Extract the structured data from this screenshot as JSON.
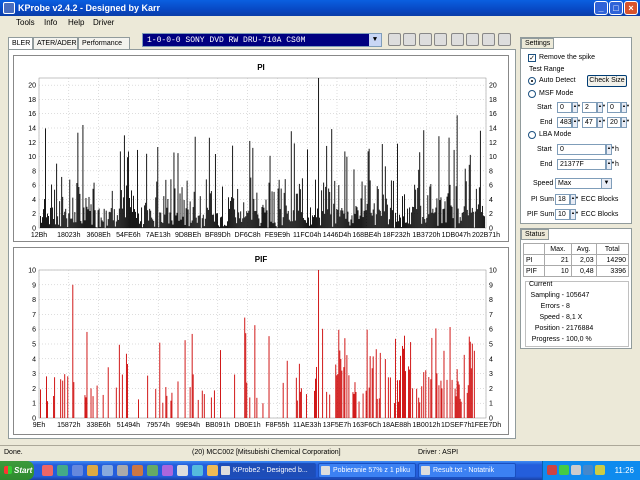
{
  "window": {
    "title": "KProbe v2.4.2 - Designed by Karr"
  },
  "menu": {
    "items": [
      "Tools",
      "Info",
      "Help",
      "Driver"
    ]
  },
  "drive": {
    "selected": "1-0-0-0 SONY    DVD RW DRU-710A  CS0M"
  },
  "tabs": [
    "BLER",
    "ATER/ADER",
    "Performance"
  ],
  "settings": {
    "title": "Settings",
    "remove_spike": "Remove the spike",
    "test_range": "Test Range",
    "auto_detect": "Auto Detect",
    "check_size": "Check Size",
    "msf_mode": "MSF Mode",
    "start_label": "Start",
    "end_label": "End",
    "msf_start": [
      "0",
      "2",
      "0"
    ],
    "msf_end": [
      "483",
      "47",
      "20"
    ],
    "lba_mode": "LBA Mode",
    "lba_start": "0",
    "lba_end": "21377F",
    "h": "h",
    "speed_label": "Speed",
    "speed_value": "Max",
    "pi_sum_label": "PI Sum",
    "pi_sum_value": "18",
    "pif_sum_label": "PIF Sum",
    "pif_sum_value": "10",
    "ecc_blocks": "ECC Blocks"
  },
  "status": {
    "title": "Status",
    "headers": [
      "",
      "Max.",
      "Avg.",
      "Total"
    ],
    "rows": [
      [
        "PI",
        "21",
        "2,03",
        "14290"
      ],
      [
        "PIF",
        "10",
        "0,48",
        "3396"
      ]
    ],
    "current_title": "Current",
    "current": [
      {
        "k": "Sampling -",
        "v": "105647"
      },
      {
        "k": "Errors -",
        "v": "8"
      },
      {
        "k": "Speed -",
        "v": "8,1  X"
      },
      {
        "k": "Position -",
        "v": "2176884"
      },
      {
        "k": "Progress -",
        "v": "100,0 %"
      }
    ]
  },
  "statusbar": {
    "left": "Done.",
    "media": "(20) MCC002 [Mitsubishi Chemical Corporation]",
    "driver": "Driver : ASPI"
  },
  "taskbar": {
    "start": "Start",
    "tasks": [
      "KProbe2 - Designed b...",
      "Pobieranie 57% z 1 pliku",
      "Result.txt - Notatnik"
    ],
    "clock": "11:26"
  },
  "colors": {
    "pi_bars": "#000000",
    "pif_bars": "#CC0000",
    "accent": "#0A5FE0"
  },
  "chart_data": [
    {
      "type": "bar",
      "title": "PI",
      "categories": [
        "12Bh",
        "18023h",
        "3608Eh",
        "54FE6h",
        "7AE13h",
        "9D8BEh",
        "BF89Dh",
        "DF6C8h",
        "FE9E9h",
        "11FC04h",
        "1446D4h",
        "168BE4h",
        "18F232h",
        "1B3720h",
        "1DB047h",
        "202B71h"
      ],
      "ylim": [
        0,
        21
      ],
      "yticks": [
        0,
        2,
        4,
        6,
        8,
        10,
        12,
        14,
        16,
        18,
        20
      ],
      "max": 21,
      "avg": 2.03
    },
    {
      "type": "bar",
      "title": "PIF",
      "categories": [
        "9Eh",
        "15872h",
        "338E6h",
        "51494h",
        "79574h",
        "99E94h",
        "BB091h",
        "DB0E1h",
        "F8F55h",
        "11AE33h",
        "13F5E7h",
        "163F6Ch",
        "18AE88h",
        "1B0012h",
        "1DSEF7h",
        "1FEE7Dh"
      ],
      "ylim": [
        0,
        10
      ],
      "yticks": [
        0,
        1,
        2,
        3,
        4,
        5,
        6,
        7,
        8,
        9,
        10
      ],
      "max": 10,
      "avg": 0.48
    }
  ]
}
